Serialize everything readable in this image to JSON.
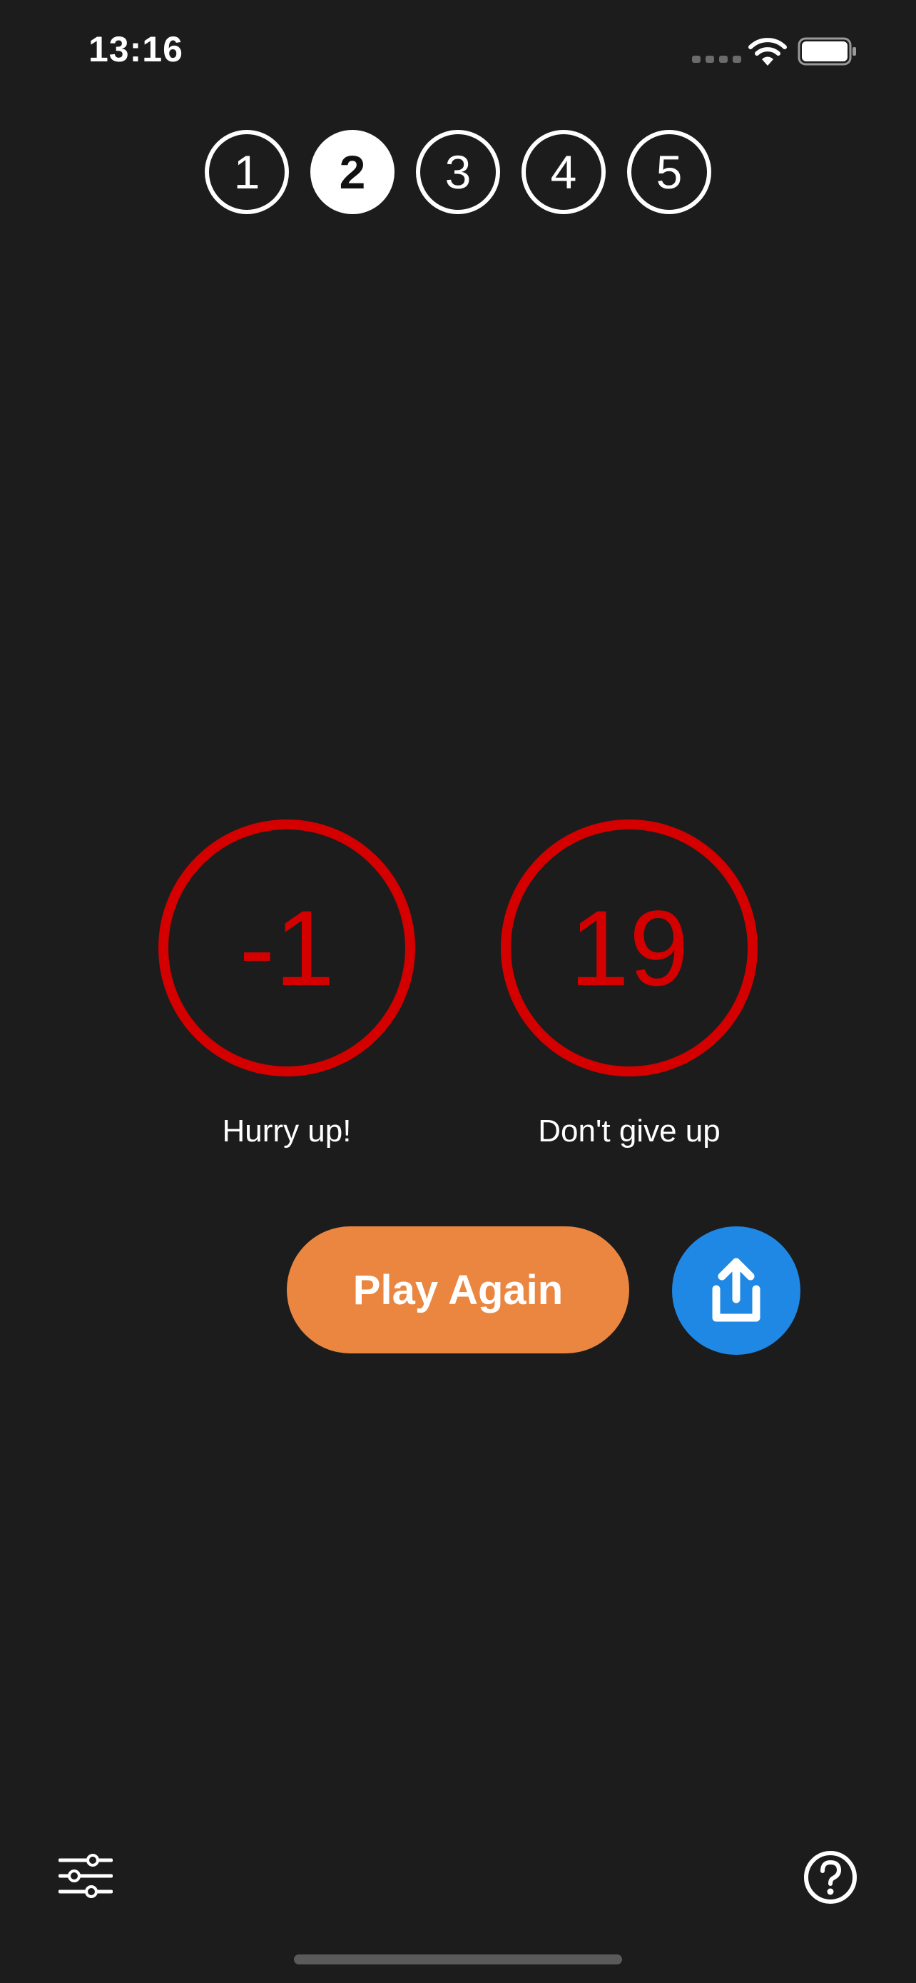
{
  "status_bar": {
    "time": "13:16"
  },
  "rounds": {
    "items": [
      "1",
      "2",
      "3",
      "4",
      "5"
    ],
    "selected": "2"
  },
  "scores": {
    "left": {
      "value": "-1",
      "caption": "Hurry up!"
    },
    "right": {
      "value": "19",
      "caption": "Don't give up"
    }
  },
  "actions": {
    "play_again_label": "Play Again",
    "share_icon": "share-icon"
  },
  "bottom_bar": {
    "settings_icon": "sliders-icon",
    "help_icon": "question-circle-icon"
  },
  "colors": {
    "background": "#1c1c1c",
    "score_red": "#d40000",
    "play_again_orange": "#ea8640",
    "share_blue": "#1f88e5"
  }
}
